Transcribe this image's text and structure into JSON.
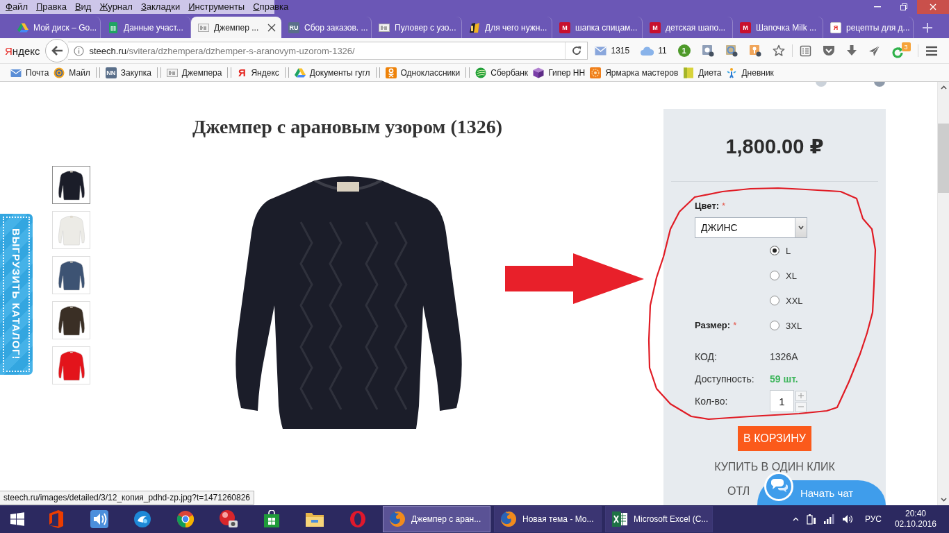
{
  "menu_bar": {
    "items": [
      "Файл",
      "Правка",
      "Вид",
      "Журнал",
      "Закладки",
      "Инструменты",
      "Справка"
    ]
  },
  "tabs": [
    {
      "title": "Мой диск – Go...",
      "kind": "drive",
      "selected": false
    },
    {
      "title": "Данные участ...",
      "kind": "sheets",
      "selected": false
    },
    {
      "title": "Джемпер ...",
      "kind": "steech",
      "selected": true
    },
    {
      "title": "Сбор заказов. ...",
      "kind": "tile-slate",
      "icon_text": "RU",
      "selected": false
    },
    {
      "title": "Пуловер с узо...",
      "kind": "steech",
      "selected": false
    },
    {
      "title": "Для чего нужн...",
      "kind": "lif",
      "selected": false
    },
    {
      "title": "шапка спицам...",
      "kind": "tile-red",
      "icon_text": "M",
      "selected": false
    },
    {
      "title": "детская шапо...",
      "kind": "tile-red",
      "icon_text": "M",
      "selected": false
    },
    {
      "title": "Шапочка Milk ...",
      "kind": "tile-red",
      "icon_text": "M",
      "selected": false
    },
    {
      "title": "рецепты для д...",
      "kind": "tile-white",
      "icon_text": "Я",
      "selected": false
    }
  ],
  "nav_bar": {
    "logo": "Яндекс",
    "url_host": "steech.ru",
    "url_path": "/svitera/dzhempera/dzhemper-s-aranovym-uzorom-1326/",
    "toolbar": [
      {
        "kind": "mail",
        "count": "1315"
      },
      {
        "kind": "cloud",
        "count": "11"
      },
      {
        "kind": "counter",
        "count": "1"
      },
      {
        "kind": "ext-blue"
      },
      {
        "kind": "ext-ring"
      },
      {
        "kind": "ext-orange"
      },
      {
        "kind": "star"
      },
      {
        "kind": "reader"
      },
      {
        "kind": "pocket"
      },
      {
        "kind": "download"
      },
      {
        "kind": "send"
      },
      {
        "kind": "sync",
        "badge": "3"
      },
      {
        "kind": "menu"
      }
    ]
  },
  "bookmark_groups": [
    {
      "items": [
        {
          "label": "Почта",
          "kind": "mail"
        },
        {
          "label": "Майл",
          "kind": "at"
        }
      ]
    },
    {
      "items": [
        {
          "label": "Закупка",
          "kind": "tile-slate",
          "icon_text": "NN"
        }
      ]
    },
    {
      "items": [
        {
          "label": "Джемпера",
          "kind": "steech"
        }
      ]
    },
    {
      "items": [
        {
          "label": "Яндекс",
          "kind": "ya",
          "icon_text": "Я"
        }
      ]
    },
    {
      "items": [
        {
          "label": "Документы гугл",
          "kind": "drive"
        }
      ]
    },
    {
      "items": [
        {
          "label": "Одноклассники",
          "kind": "ok"
        }
      ]
    },
    {
      "items": [
        {
          "label": "Сбербанк",
          "kind": "sber"
        },
        {
          "label": "Гипер НН",
          "kind": "cube"
        },
        {
          "label": "Ярмарка мастеров",
          "kind": "flower"
        },
        {
          "label": "Диета",
          "kind": "square"
        },
        {
          "label": "Дневник",
          "kind": "figure"
        }
      ]
    }
  ],
  "page": {
    "side_tab": "ВЫГРУЗИТЬ КАТАЛОГ!",
    "title": "Джемпер с арановым узором (1326)",
    "thumbnails": [
      {
        "color": "#1b1d29",
        "selected": true
      },
      {
        "color": "#ecebe6",
        "selected": false
      },
      {
        "color": "#3d5373",
        "selected": false
      },
      {
        "color": "#3a2f25",
        "selected": false
      },
      {
        "color": "#e3141b",
        "selected": false
      }
    ],
    "product": {
      "price": "1,800.00 ₽",
      "color_field": {
        "label": "Цвет:",
        "required_mark": "*",
        "value": "ДЖИНС"
      },
      "size_field": {
        "label": "Размер:",
        "required_mark": "*",
        "options": [
          {
            "label": "L",
            "selected": true
          },
          {
            "label": "XL",
            "selected": false
          },
          {
            "label": "XXL",
            "selected": false
          },
          {
            "label": "3XL",
            "selected": false
          }
        ]
      },
      "details": [
        {
          "label": "КОД:",
          "value": "1326A",
          "kind": "plain"
        },
        {
          "label": "Доступность:",
          "value": "59 шт.",
          "kind": "stock"
        }
      ],
      "quantity_label": "Кол-во:",
      "quantity": "1",
      "add_to_cart": "В КОРЗИНУ",
      "one_click": "КУПИТЬ В ОДИН КЛИК",
      "cut_link": "ОТЛ"
    },
    "chat": {
      "label": "Начать чат"
    },
    "status_url": "steech.ru/images/detailed/3/12_копия_pdhd-zp.jpg?t=1471260826"
  },
  "taskbar": {
    "pinned": [
      {
        "kind": "office"
      },
      {
        "kind": "speaker"
      },
      {
        "kind": "swirl"
      },
      {
        "kind": "chrome"
      },
      {
        "kind": "camera"
      },
      {
        "kind": "store"
      },
      {
        "kind": "folder"
      },
      {
        "kind": "opera"
      }
    ],
    "windows": [
      {
        "title": "Джемпер с аран...",
        "kind": "firefox",
        "selected": true
      },
      {
        "title": "Новая тема - Мо...",
        "kind": "firefox",
        "selected": false
      },
      {
        "title": "Microsoft Excel (С...",
        "kind": "excel",
        "selected": false
      }
    ],
    "tray": {
      "language": "РУС",
      "time": "20:40",
      "date": "02.10.2016"
    }
  }
}
